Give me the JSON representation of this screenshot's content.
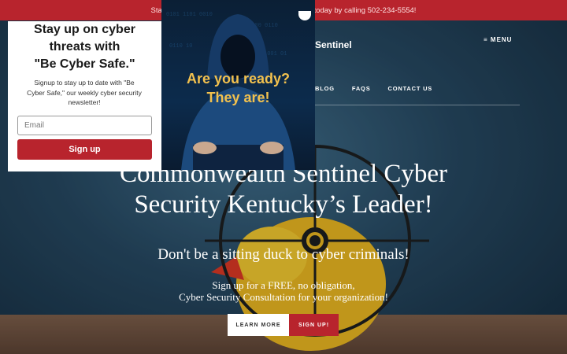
{
  "topbar": {
    "text": "Start your journey to having better cyber security today by calling 502-234-5554!"
  },
  "header": {
    "brand": "Sentinel",
    "menu_label": "MENU",
    "nav": [
      "BLOG",
      "FAQS",
      "CONTACT US"
    ]
  },
  "hero": {
    "title_line1": "Commonwealth Sentinel Cyber",
    "title_line2": "Security Kentucky’s Leader!",
    "subtitle": "Don't be a sitting duck to cyber criminals!",
    "text_line1": "Sign up for a FREE, no obligation,",
    "text_line2": "Cyber Security Consultation for your organization!",
    "learn_more": "LEARN MORE",
    "sign_up": "SIGN UP!"
  },
  "popup": {
    "title_line1": "Stay up on cyber",
    "title_line2": "threats with",
    "title_line3": "\"Be Cyber Safe.\"",
    "text": "Signup to stay up to date with \"Be Cyber Safe,\" our weekly cyber security newsletter!",
    "email_placeholder": "Email",
    "button": "Sign up",
    "image_text_line1": "Are you ready?",
    "image_text_line2": "They are!"
  },
  "colors": {
    "accent": "#b8242d",
    "image_text": "#f2c14e"
  }
}
